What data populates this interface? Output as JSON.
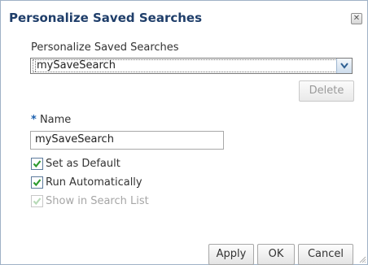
{
  "dialog": {
    "title": "Personalize Saved Searches",
    "close_icon": "close-icon"
  },
  "saved_search": {
    "label": "Personalize Saved Searches",
    "selected": "mySaveSearch",
    "options": [
      "mySaveSearch"
    ],
    "dropdown_icon": "chevron-down-icon"
  },
  "delete_label": "Delete",
  "name_field": {
    "required_marker": "*",
    "label": "Name",
    "value": "mySaveSearch"
  },
  "checkboxes": [
    {
      "label": "Set as Default",
      "checked": true,
      "disabled": false
    },
    {
      "label": "Run Automatically",
      "checked": true,
      "disabled": false
    },
    {
      "label": "Show in Search List",
      "checked": true,
      "disabled": true
    }
  ],
  "footer": {
    "apply_label": "Apply",
    "ok_label": "OK",
    "cancel_label": "Cancel"
  },
  "colors": {
    "title": "#1f3e6a",
    "checkmark": "#2e9b2e",
    "checkmark_disabled": "#b7d9b7",
    "border": "#9fb2c6"
  }
}
